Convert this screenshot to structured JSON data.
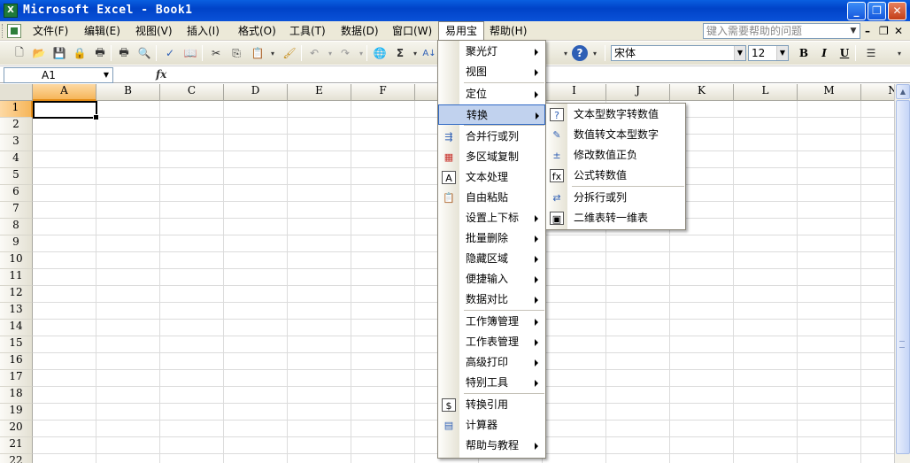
{
  "window": {
    "title": "Microsoft Excel - Book1",
    "app_icon": "excel-icon",
    "controls": [
      "minimize",
      "maximize",
      "close"
    ]
  },
  "menubar": {
    "items": [
      "文件(F)",
      "编辑(E)",
      "视图(V)",
      "插入(I)",
      "格式(O)",
      "工具(T)",
      "数据(D)",
      "窗口(W)",
      "易用宝",
      "帮助(H)"
    ],
    "active": "易用宝",
    "help_placeholder": "键入需要帮助的问题"
  },
  "toolbar": {
    "font_name": "宋体",
    "font_size": "12",
    "bold": "B",
    "italic": "I",
    "underline": "U",
    "sigma": "Σ",
    "sort": "A↓"
  },
  "formula_bar": {
    "name_box": "A1",
    "fx": "fx",
    "content": ""
  },
  "sheet": {
    "columns": [
      "A",
      "B",
      "C",
      "D",
      "E",
      "F",
      "G",
      "H",
      "I",
      "J",
      "K",
      "L",
      "M",
      "N"
    ],
    "rows": [
      "1",
      "2",
      "3",
      "4",
      "5",
      "6",
      "7",
      "8",
      "9",
      "10",
      "11",
      "12",
      "13",
      "14",
      "15",
      "16",
      "17",
      "18",
      "19",
      "20",
      "21",
      "22"
    ],
    "active_cell": "A1"
  },
  "easy_menu": {
    "items": [
      {
        "label": "聚光灯",
        "submenu": true
      },
      {
        "label": "视图",
        "submenu": true
      },
      {
        "label": "定位",
        "submenu": true
      },
      {
        "label": "转换",
        "submenu": true,
        "highlighted": true
      },
      {
        "label": "合并行或列",
        "icon": "merge-icon"
      },
      {
        "label": "多区域复制",
        "icon": "multi-copy-icon"
      },
      {
        "label": "文本处理",
        "icon": "text-process-icon"
      },
      {
        "label": "自由粘贴",
        "icon": "paste-icon"
      },
      {
        "label": "设置上下标",
        "submenu": true
      },
      {
        "label": "批量删除",
        "submenu": true
      },
      {
        "label": "隐藏区域",
        "submenu": true
      },
      {
        "label": "便捷输入",
        "submenu": true
      },
      {
        "label": "数据对比",
        "submenu": true
      },
      {
        "label": "工作簿管理",
        "submenu": true
      },
      {
        "label": "工作表管理",
        "submenu": true
      },
      {
        "label": "高级打印",
        "submenu": true
      },
      {
        "label": "特别工具",
        "submenu": true
      },
      {
        "label": "转换引用",
        "icon": "convert-ref-icon"
      },
      {
        "label": "计算器",
        "icon": "calculator-icon"
      },
      {
        "label": "帮助与教程",
        "submenu": true
      }
    ]
  },
  "convert_submenu": {
    "items": [
      {
        "label": "文本型数字转数值",
        "icon": "text-to-number-icon"
      },
      {
        "label": "数值转文本型数字",
        "icon": "number-to-text-icon"
      },
      {
        "label": "修改数值正负",
        "icon": "plus-minus-icon"
      },
      {
        "label": "公式转数值",
        "icon": "formula-to-value-icon"
      },
      {
        "label": "分拆行或列",
        "icon": "split-icon"
      },
      {
        "label": "二维表转一维表",
        "icon": "table-convert-icon"
      }
    ]
  }
}
